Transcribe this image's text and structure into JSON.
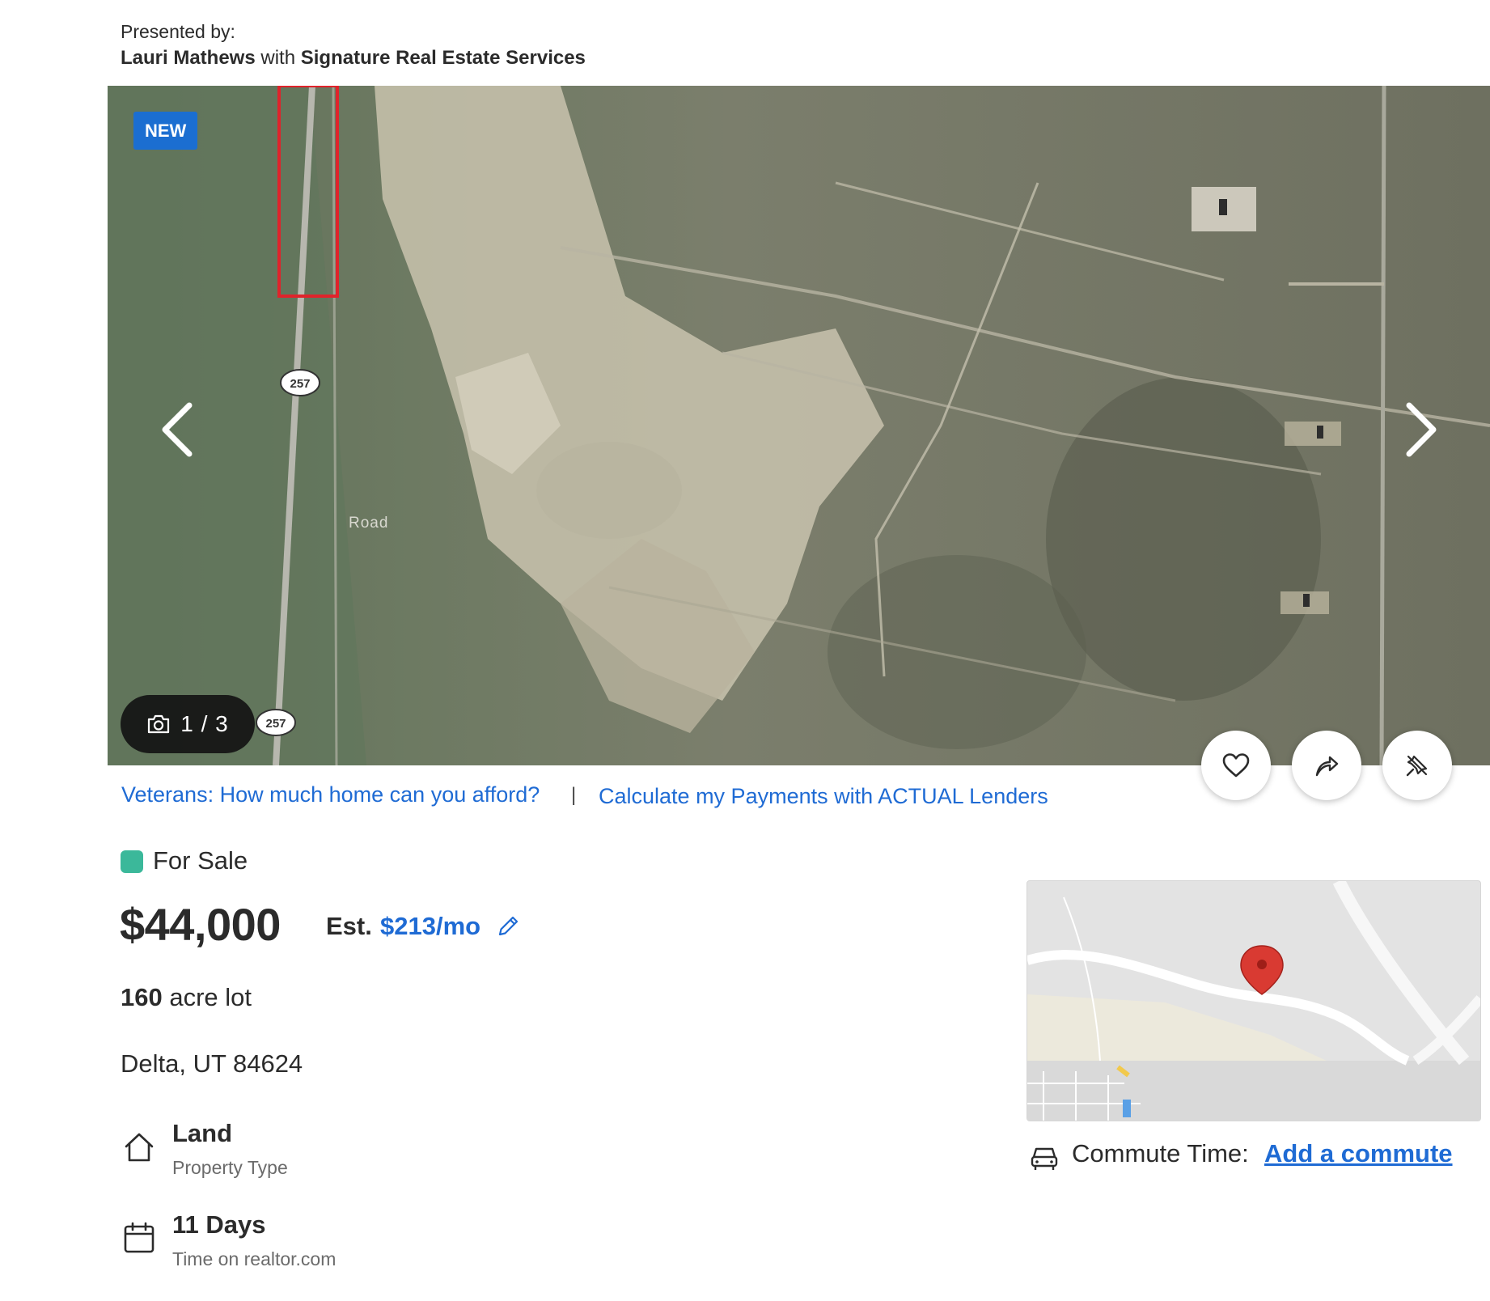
{
  "presented_by": {
    "label": "Presented by:",
    "agent": "Lauri Mathews",
    "connector": "with",
    "brokerage": "Signature Real Estate Services"
  },
  "hero": {
    "badge": "NEW",
    "counter": "1 / 3",
    "map_labels": {
      "route_top": "257",
      "route_bottom": "257",
      "road": "Road"
    }
  },
  "links": {
    "veterans": "Veterans: How much home can you afford?",
    "divider": "|",
    "calculate": "Calculate my Payments with ACTUAL Lenders"
  },
  "listing": {
    "status": "For Sale",
    "status_color": "#3bb89a",
    "price": "$44,000",
    "est_label": "Est.",
    "est_value": "$213/mo",
    "lot_number": "160",
    "lot_unit": "acre lot",
    "address": "Delta, UT 84624"
  },
  "facts": [
    {
      "value": "Land",
      "label": "Property Type",
      "icon": "house-icon"
    },
    {
      "value": "11 Days",
      "label": "Time on realtor.com",
      "icon": "calendar-icon"
    }
  ],
  "commute": {
    "label": "Commute Time:",
    "link": "Add a commute"
  },
  "colors": {
    "link_blue": "#1f6bd4",
    "badge_blue": "#1b6ed1",
    "pin_red": "#d93a32"
  }
}
